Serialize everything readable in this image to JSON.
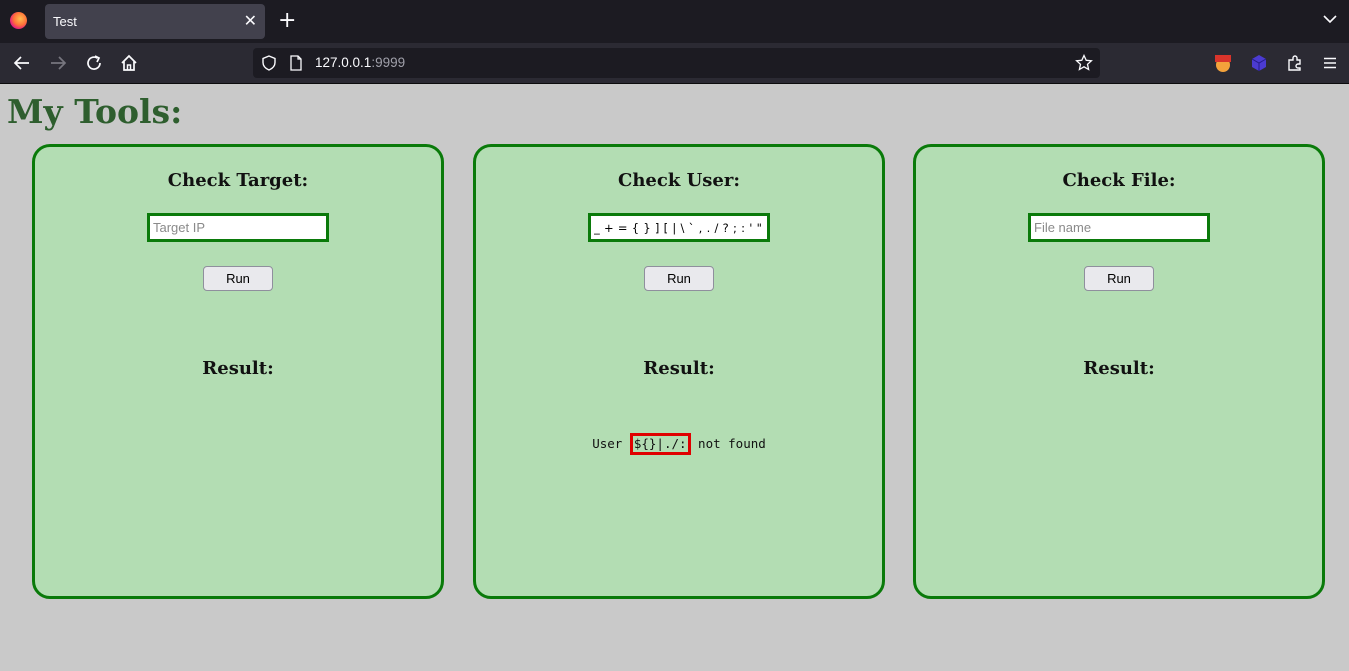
{
  "browser": {
    "tab_title": "Test",
    "tab_close": "✕",
    "new_tab": "+",
    "url_host": "127.0.0.1",
    "url_port": ":9999"
  },
  "page": {
    "title": "My Tools:"
  },
  "panels": [
    {
      "heading": "Check Target:",
      "input_placeholder": "Target IP",
      "input_value": "",
      "run_label": "Run",
      "result_heading": "Result:"
    },
    {
      "heading": "Check User:",
      "input_placeholder": "",
      "input_value": "_ + = { } ] [ | \\ ` , . / ? ; : ' \" < >",
      "run_label": "Run",
      "result_heading": "Result:",
      "result_prefix": "User ",
      "result_highlight": "${}|./:",
      "result_suffix": " not found"
    },
    {
      "heading": "Check File:",
      "input_placeholder": "File name",
      "input_value": "",
      "run_label": "Run",
      "result_heading": "Result:"
    }
  ],
  "colors": {
    "panel_bg": "#b3ddb3",
    "panel_border": "#0a7a0a",
    "title": "#2e5e2e",
    "highlight_border": "#e00000"
  }
}
